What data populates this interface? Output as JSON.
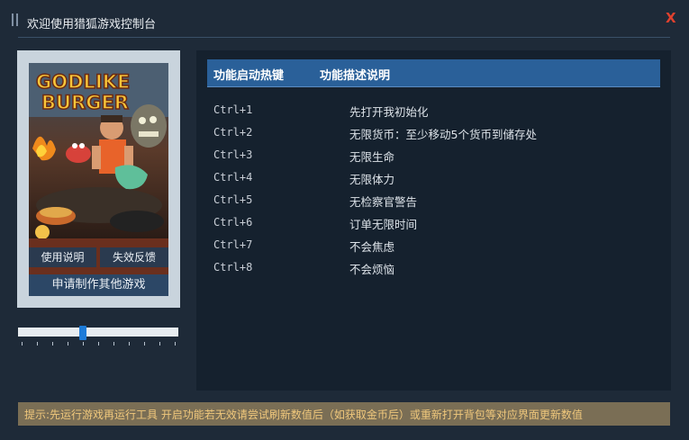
{
  "window": {
    "title": "欢迎使用猎狐游戏控制台",
    "close_label": "X"
  },
  "game": {
    "cover_logo_line1": "GODLIKE",
    "cover_logo_line2": "BURGER"
  },
  "buttons": {
    "manual": "使用说明",
    "feedback": "失效反馈",
    "request": "申请制作其他游戏"
  },
  "slider": {
    "value_fraction": 0.4
  },
  "table": {
    "headers": {
      "hotkey": "功能启动热键",
      "description": "功能描述说明"
    },
    "rows": [
      {
        "key": "Ctrl+1",
        "desc": "先打开我初始化"
      },
      {
        "key": "Ctrl+2",
        "desc": "无限货币：至少移动5个货币到储存处"
      },
      {
        "key": "Ctrl+3",
        "desc": "无限生命"
      },
      {
        "key": "Ctrl+4",
        "desc": "无限体力"
      },
      {
        "key": "Ctrl+5",
        "desc": "无检察官警告"
      },
      {
        "key": "Ctrl+6",
        "desc": "订单无限时间"
      },
      {
        "key": "Ctrl+7",
        "desc": "不会焦虑"
      },
      {
        "key": "Ctrl+8",
        "desc": "不会烦恼"
      }
    ]
  },
  "tip": {
    "text": "提示:先运行游戏再运行工具 开启功能若无效请尝试刷新数值后（如获取金币后）或重新打开背包等对应界面更新数值"
  },
  "colors": {
    "background": "#1e2a38",
    "panel": "#15212e",
    "header_accent": "#2a6099",
    "close": "#e0412e",
    "tip_text": "#f0c87c",
    "slider_thumb": "#1d7bd8"
  }
}
